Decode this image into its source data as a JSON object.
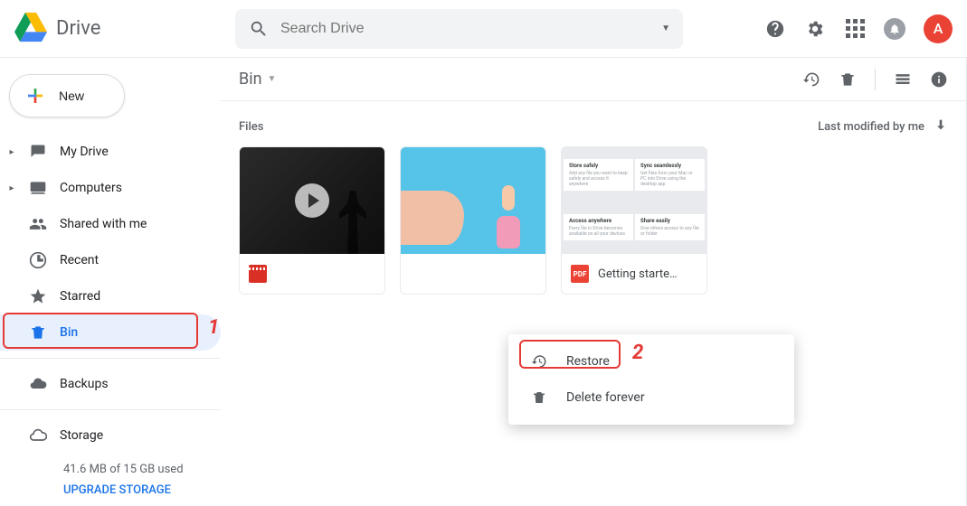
{
  "product_name": "Drive",
  "search": {
    "placeholder": "Search Drive"
  },
  "avatar_letter": "A",
  "new_button": "New",
  "sidebar": {
    "items": [
      {
        "label": "My Drive"
      },
      {
        "label": "Computers"
      },
      {
        "label": "Shared with me"
      },
      {
        "label": "Recent"
      },
      {
        "label": "Starred"
      },
      {
        "label": "Bin"
      },
      {
        "label": "Backups"
      },
      {
        "label": "Storage"
      }
    ]
  },
  "storage": {
    "text": "41.6 MB of 15 GB used",
    "upgrade": "UPGRADE STORAGE"
  },
  "breadcrumb": "Bin",
  "section_head": "Files",
  "sort_label": "Last modified by me",
  "files": [
    {
      "name": "",
      "type": "video"
    },
    {
      "name": "",
      "type": "photo"
    },
    {
      "name": "Getting starte…",
      "type": "pdf"
    }
  ],
  "pdf_grid": {
    "cells": [
      {
        "title": "Store safely",
        "blurb": "Add any file you want to keep safely and access it anywhere"
      },
      {
        "title": "Sync seamlessly",
        "blurb": "Get files from your Mac or PC into Drive using the desktop app"
      },
      {
        "title": "Access anywhere",
        "blurb": "Every file in Drive becomes available on all your devices"
      },
      {
        "title": "Share easily",
        "blurb": "Give others access to any file or folder"
      }
    ]
  },
  "context_menu": {
    "restore": "Restore",
    "delete_forever": "Delete forever"
  },
  "annotations": {
    "one": "1",
    "two": "2"
  }
}
